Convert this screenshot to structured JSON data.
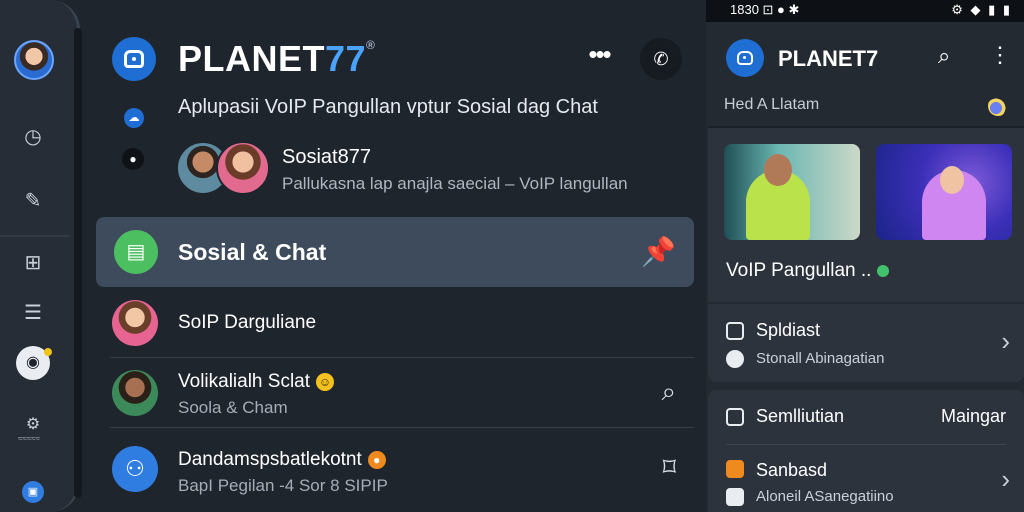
{
  "rail": {
    "small_label": "≈≈≈≈≈"
  },
  "header": {
    "brand_part1": "PLANET",
    "brand_part2": "77",
    "brand_mark": "®",
    "more_label": "•••",
    "call_label": "✆",
    "subtitle": "Aplupasii VoIP Pangullan vptur Sosial dag Chat"
  },
  "feature": {
    "title": "Sosiat877",
    "subtitle": "Pallukasna lap anajla saecial – VoIP langullan"
  },
  "list": {
    "active": {
      "label": "Sosial & Chat"
    },
    "items": [
      {
        "title": "SoIP Darguliane",
        "subtitle": ""
      },
      {
        "title": "Volikalialh Sclat",
        "subtitle": "Soola & Cham"
      },
      {
        "title": "Dandamspsbatlekotnt",
        "subtitle": "BapI Pegilan -4 Sor 8 SIPIP"
      }
    ]
  },
  "phone": {
    "status_time": "1830",
    "status_left_icons": "⊡ ● ✱",
    "status_right_icons": "⚙ ◆ ▮ ▮",
    "brand": "PLANET7",
    "header_text": "Hed A Llatam",
    "card_title": "VoIP Pangullan ..",
    "item1": {
      "title": "Spldiast",
      "subtitle": "Stonall Abinagatian"
    },
    "item2": {
      "title": "Semlliutian",
      "right": "Maingar"
    },
    "item3": {
      "title": "Sanbasd",
      "subtitle": "Aloneil ASanegatiino"
    }
  },
  "colors": {
    "accent": "#1f6ed4",
    "brand_highlight": "#4aa3ff",
    "active_row": "#3e4b5c",
    "social_green": "#4cbf61",
    "background": "#1f252d"
  }
}
